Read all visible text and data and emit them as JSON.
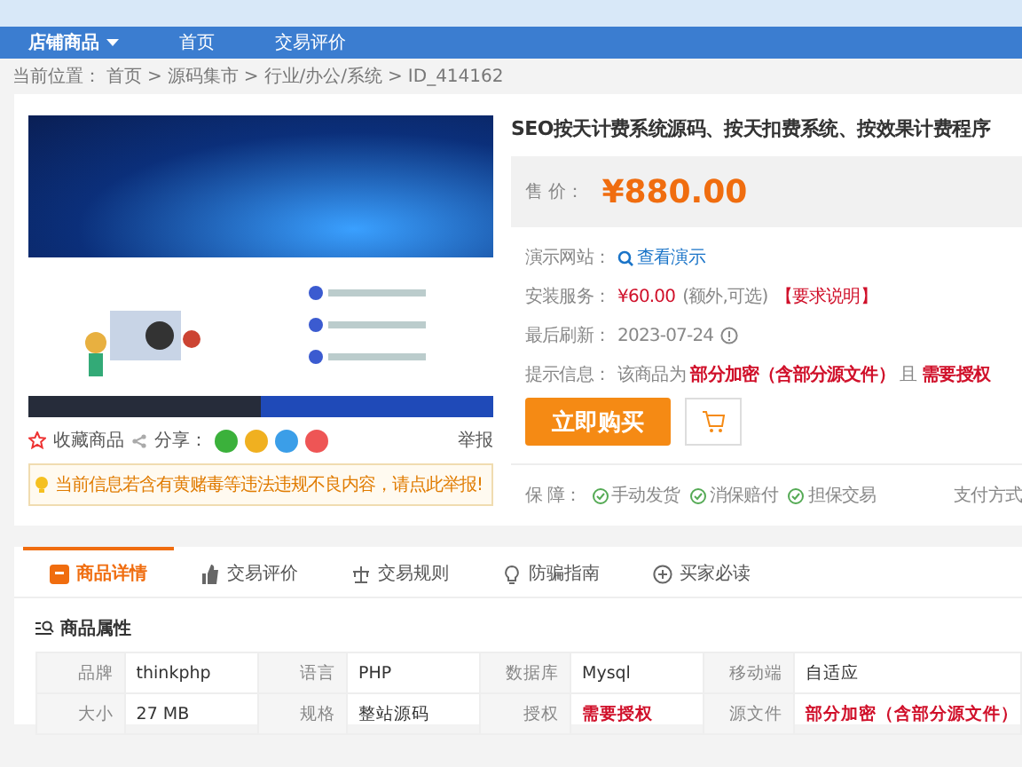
{
  "nav": {
    "items": [
      {
        "label": "店铺商品",
        "dropdown": true,
        "selected": true
      },
      {
        "label": "首页",
        "dropdown": false,
        "selected": false
      },
      {
        "label": "交易评价",
        "dropdown": false,
        "selected": false
      }
    ]
  },
  "breadcrumb": {
    "prefix": "当前位置：",
    "separator": ">",
    "items": [
      "首页",
      "源码集市",
      "行业/办公/系统",
      "ID_414162"
    ]
  },
  "product": {
    "title": "SEO按天计费系统源码、按天扣费系统、按效果计费程序",
    "price_label": "售 价：",
    "price": "¥880.00",
    "demo": {
      "label": "演示网站：",
      "link": "查看演示"
    },
    "install": {
      "label": "安装服务：",
      "price": "¥60.00",
      "note": "(额外,可选)",
      "link": "【要求说明】"
    },
    "refresh": {
      "label": "最后刷新：",
      "date": "2023-07-24"
    },
    "notice": {
      "label": "提示信息：",
      "text": "该商品为 **部分加密（含部分源文件）** 且 **需要授权**"
    },
    "buy_button": "立即购买",
    "guarantee": {
      "label": "保 障：",
      "items": [
        "手动发货",
        "消保赔付",
        "担保交易"
      ]
    },
    "payment": "支付方式"
  },
  "gallery": {
    "favorite": "收藏商品",
    "share": "分享：",
    "report": "举报",
    "warning": "当前信息若含有黄赌毒等违法违规不良内容，请点此举报!"
  },
  "tabs": [
    {
      "label": "商品详情",
      "selected": true,
      "kind": "doc"
    },
    {
      "label": "交易评价",
      "selected": false,
      "kind": "thumb"
    },
    {
      "label": "交易规则",
      "selected": false,
      "kind": "scale"
    },
    {
      "label": "防骗指南",
      "selected": false,
      "kind": "bulb"
    },
    {
      "label": "买家必读",
      "selected": false,
      "kind": "plus"
    }
  ],
  "attributes": {
    "title": "商品属性",
    "rows": [
      [
        {
          "name": "品牌",
          "value": "thinkphp",
          "emphasis": false
        },
        {
          "name": "语言",
          "value": "PHP",
          "emphasis": false
        },
        {
          "name": "数据库",
          "value": "Mysql",
          "emphasis": false
        },
        {
          "name": "移动端",
          "value": "自适应",
          "emphasis": false
        }
      ],
      [
        {
          "name": "大小",
          "value": "27 MB",
          "emphasis": false
        },
        {
          "name": "规格",
          "value": "整站源码",
          "emphasis": false
        },
        {
          "name": "授权",
          "value": "需要授权",
          "emphasis": true
        },
        {
          "name": "源文件",
          "value": "部分加密（含部分源文件）",
          "emphasis": true
        }
      ]
    ]
  }
}
